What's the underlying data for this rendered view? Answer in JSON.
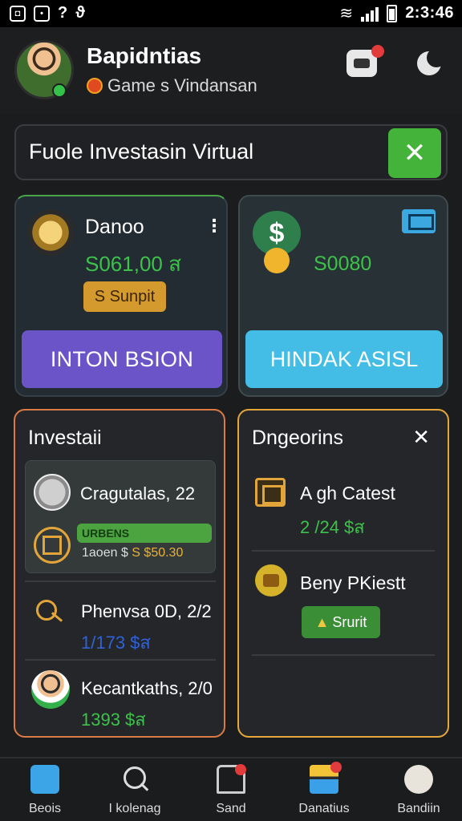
{
  "status_bar": {
    "time": "2:3:46"
  },
  "header": {
    "user_name": "Bapidntias",
    "user_subtitle": "Game s Vindansan"
  },
  "title_bar": {
    "title": "Fuole Investasin Virtual"
  },
  "card_a": {
    "name": "Danoo",
    "amount": "S061,00 ส",
    "badge": "S Sunpit",
    "button": "INTON BSION"
  },
  "card_b": {
    "amount": "S0080",
    "button": "HINDAK ASISL"
  },
  "panel_left": {
    "title": "Investaii",
    "rows": [
      {
        "name": "Cragutalas, 22",
        "bar_label": "URBENS",
        "detail_a": "1aoen $",
        "detail_b": "S $50.30"
      },
      {
        "name": "Phenvsa 0D, 2/2",
        "amount": "1/173 $ส"
      },
      {
        "name": "Kecantkaths, 2/0",
        "amount": "1393 $ส"
      }
    ]
  },
  "panel_right": {
    "title": "Dngeorins",
    "rows": [
      {
        "name": "A gh Catest",
        "amount": "2 /24 $ส"
      },
      {
        "name": "Beny PKiestt",
        "button": "Srurit"
      }
    ]
  },
  "nav": [
    {
      "label": "Beois"
    },
    {
      "label": "I kolenag"
    },
    {
      "label": "Sand"
    },
    {
      "label": "Danatius"
    },
    {
      "label": "Bandiin"
    }
  ]
}
